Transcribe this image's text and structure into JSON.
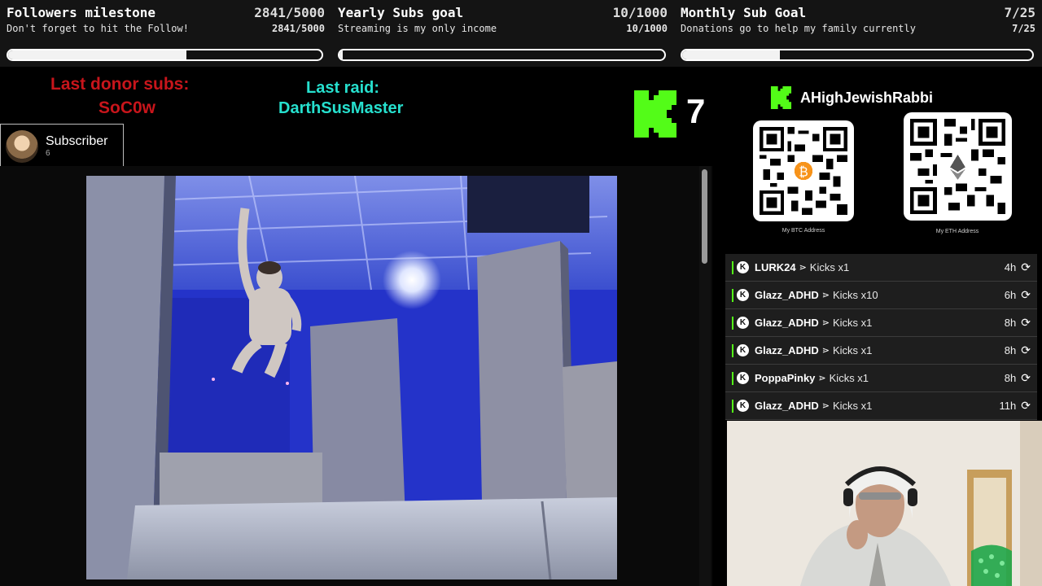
{
  "goals": [
    {
      "title": "Followers milestone",
      "count": "2841/5000",
      "subtitle": "Don't forget to hit the Follow!",
      "subcount": "2841/5000",
      "progress": 0.568
    },
    {
      "title": "Yearly Subs goal",
      "count": "10/1000",
      "subtitle": "Streaming is my only income",
      "subcount": "10/1000",
      "progress": 0.01
    },
    {
      "title": "Monthly Sub Goal",
      "count": "7/25",
      "subtitle": "Donations go to help my family currently",
      "subcount": "7/25",
      "progress": 0.28
    }
  ],
  "donor": {
    "label": "Last donor subs:",
    "name": "SoC0w"
  },
  "raid": {
    "label": "Last raid:",
    "name": "DarthSusMaster"
  },
  "subscriber": {
    "title": "Subscriber",
    "count": "6"
  },
  "kick": {
    "count": "7",
    "channel": "AHighJewishRabbi"
  },
  "qr": {
    "btc_caption": "My BTC Address",
    "eth_caption": "My ETH Address",
    "btc_icon": "bitcoin-icon",
    "eth_icon": "ethereum-icon"
  },
  "feed": [
    {
      "user": "LURK24",
      "gift": "Kicks x1",
      "time": "4h"
    },
    {
      "user": "Glazz_ADHD",
      "gift": "Kicks x10",
      "time": "6h"
    },
    {
      "user": "Glazz_ADHD",
      "gift": "Kicks x1",
      "time": "8h"
    },
    {
      "user": "Glazz_ADHD",
      "gift": "Kicks x1",
      "time": "8h"
    },
    {
      "user": "PoppaPinky",
      "gift": "Kicks x1",
      "time": "8h"
    },
    {
      "user": "Glazz_ADHD",
      "gift": "Kicks x1",
      "time": "11h"
    }
  ],
  "feed_badge": "K",
  "feed_arrow": "⋗",
  "feed_replay": "⟳",
  "colors": {
    "kick_green": "#53fc18",
    "donor_red": "#c8151b",
    "raid_teal": "#26e0ce",
    "btc_orange": "#f7931a"
  }
}
